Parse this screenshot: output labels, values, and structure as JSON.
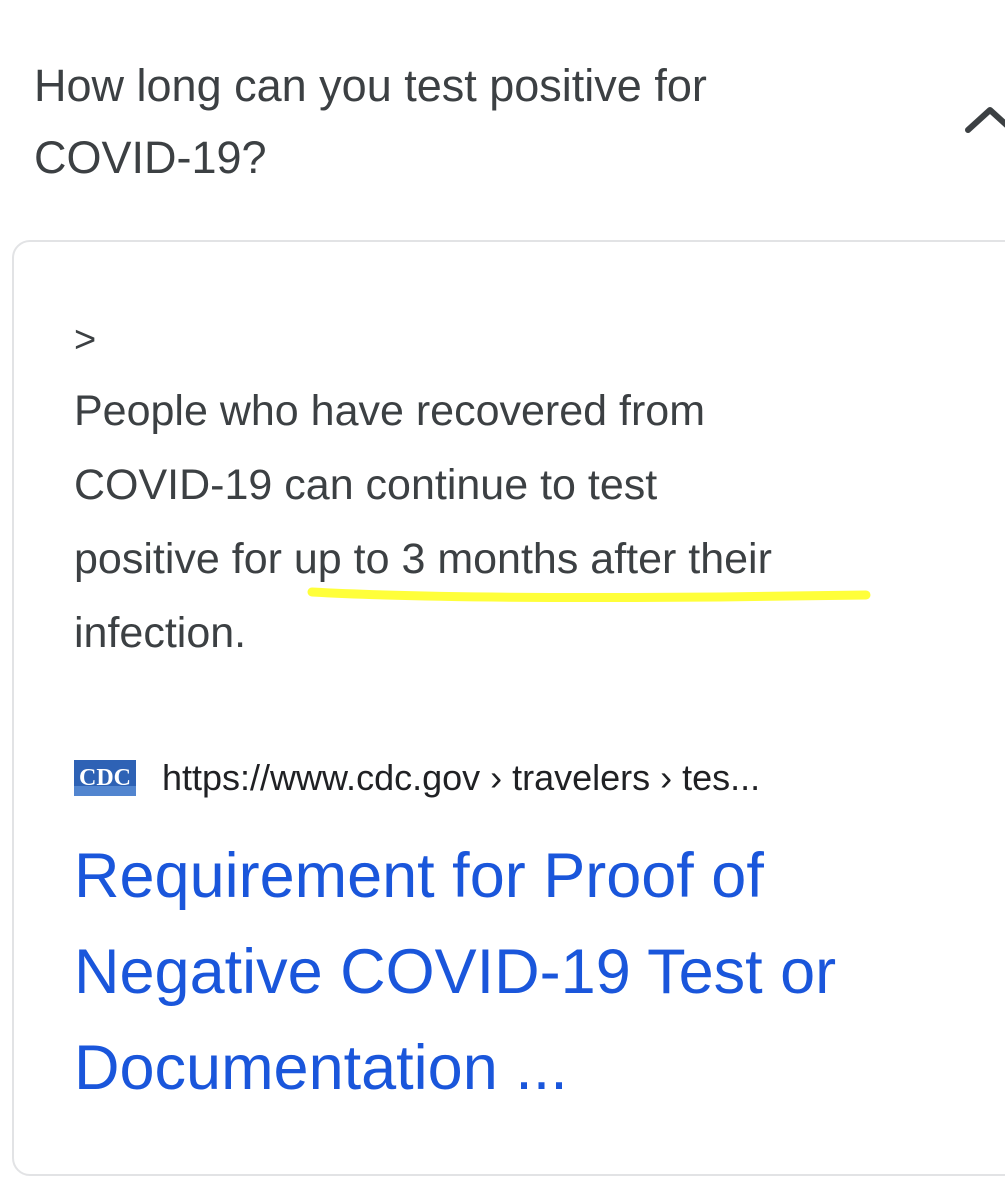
{
  "question": {
    "lines": [
      "How long can you test positive for",
      "COVID-19?"
    ]
  },
  "answer": {
    "marker": ">",
    "snippet_lines": [
      "People who have recovered from",
      "COVID-19 can continue to test",
      "positive for up to 3 months after their",
      "infection."
    ],
    "highlight_color": "#ffff3a",
    "source": {
      "logo_text": "CDC",
      "url": "https://www.cdc.gov › travelers › tes..."
    },
    "result_title_lines": [
      "Requirement for Proof of",
      "Negative COVID-19 Test or",
      "Documentation ..."
    ]
  },
  "colors": {
    "text": "#3c4043",
    "link": "#1a56db",
    "card_border": "#e2e3e5",
    "cdc_blue": "#2e62b5"
  },
  "icons": {
    "collapse": "chevron-up-icon",
    "source_logo": "cdc-logo"
  }
}
